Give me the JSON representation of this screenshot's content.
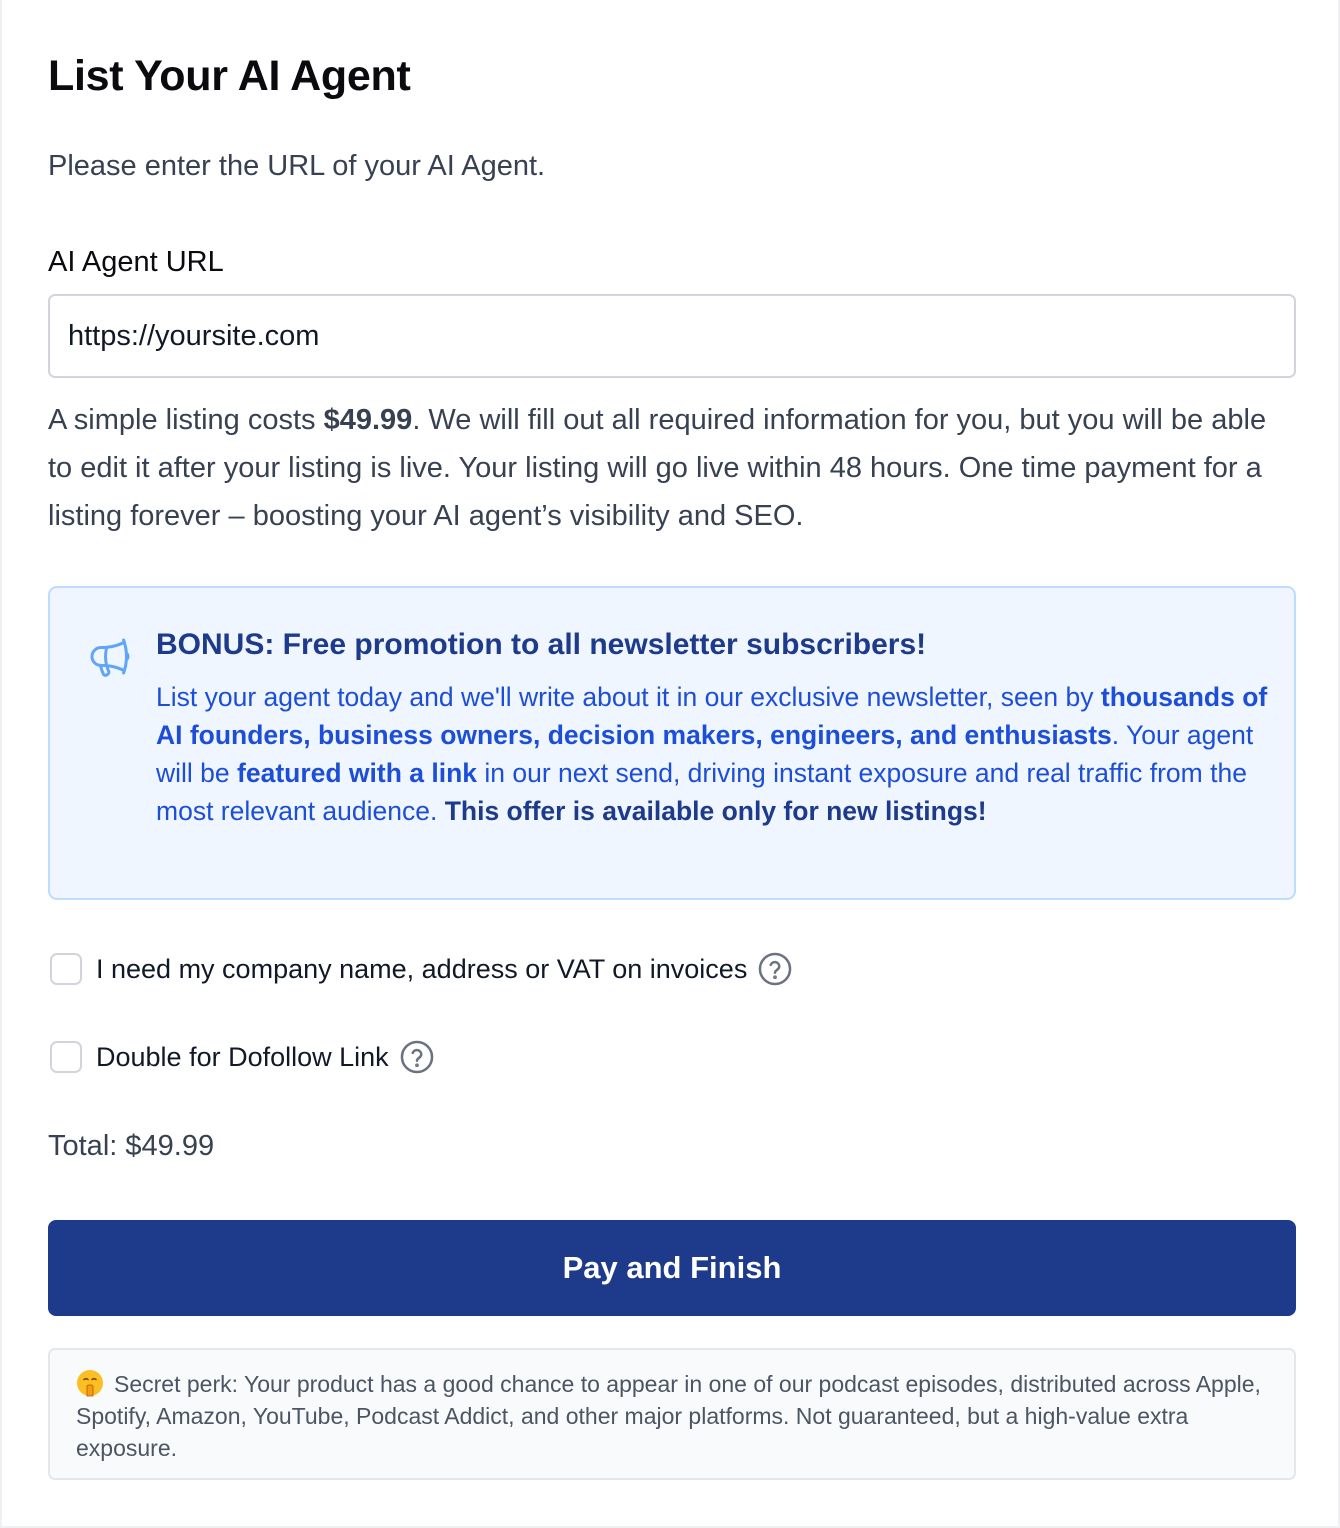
{
  "page": {
    "title": "List Your AI Agent",
    "subtitle": "Please enter the URL of your AI Agent."
  },
  "url_field": {
    "label": "AI Agent URL",
    "placeholder": "https://yoursite.com",
    "value": ""
  },
  "description": {
    "part1": "A simple listing costs ",
    "price": "$49.99",
    "part2": ". We will fill out all required information for you, but you will be able to edit it after your listing is live. Your listing will go live within 48 hours. One time payment for a listing forever – boosting your AI agent’s visibility and SEO."
  },
  "bonus": {
    "icon": "megaphone-icon",
    "title": "BONUS: Free promotion to all newsletter subscribers!",
    "text1": "List your agent today",
    "text2": " and we'll write about it in our exclusive newsletter, seen by ",
    "text3": "thousands of AI founders, business owners, decision makers, engineers, and enthusiasts",
    "text4": ". Your agent will be ",
    "text5": "featured with a link",
    "text6": " in our next send, driving instant exposure and real traffic from the most relevant audience. ",
    "text7": "This offer is available only for new listings!"
  },
  "options": [
    {
      "label": "I need my company name, address or VAT on invoices",
      "checked": false
    },
    {
      "label": "Double for Dofollow Link",
      "checked": false
    }
  ],
  "total": "Total: $49.99",
  "pay_button": "Pay and Finish",
  "perk": {
    "icon": "shushing-face-emoji",
    "text": "Secret perk: Your product has a good chance to appear in one of our podcast episodes, distributed across Apple, Spotify, Amazon, YouTube, Podcast Addict, and other major platforms. Not guaranteed, but a high-value extra exposure."
  },
  "colors": {
    "primary": "#1e3a8a",
    "link_blue": "#1d4ed8",
    "bonus_bg": "#eff6ff",
    "bonus_border": "#bfdbfe",
    "text_gray": "#374151"
  }
}
